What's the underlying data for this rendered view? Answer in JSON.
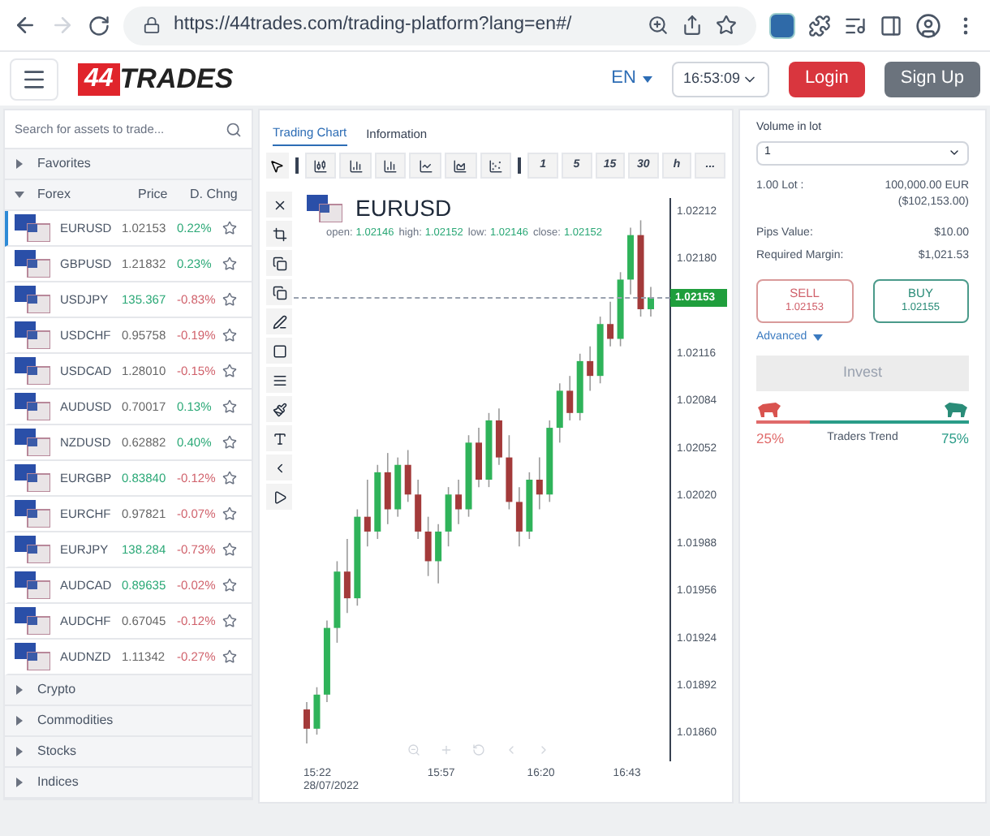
{
  "browser": {
    "url": "https://44trades.com/trading-platform?lang=en#/"
  },
  "header": {
    "logo_mark": "44",
    "logo_text": "TRADES",
    "language": "EN",
    "time": "16:53:09",
    "login": "Login",
    "signup": "Sign Up"
  },
  "assets": {
    "search_placeholder": "Search for assets to trade...",
    "groups_before": [
      {
        "label": "Favorites",
        "expanded": false
      }
    ],
    "forex": {
      "label": "Forex",
      "expanded": true,
      "price_header": "Price",
      "change_header": "D. Chng",
      "rows": [
        {
          "symbol": "EURUSD",
          "price": {
            "text": "1.02153",
            "color": "#666666"
          },
          "change": {
            "text": "0.22%",
            "color": "#2aa876"
          },
          "selected": true
        },
        {
          "symbol": "GBPUSD",
          "price": {
            "text": "1.21832",
            "color": "#666666"
          },
          "change": {
            "text": "0.23%",
            "color": "#2aa876"
          },
          "selected": false
        },
        {
          "symbol": "USDJPY",
          "price": {
            "text": "135.367",
            "color": "#2aa876"
          },
          "change": {
            "text": "-0.83%",
            "color": "#d0616b"
          },
          "selected": false
        },
        {
          "symbol": "USDCHF",
          "price": {
            "text": "0.95758",
            "color": "#666666"
          },
          "change": {
            "text": "-0.19%",
            "color": "#d0616b"
          },
          "selected": false
        },
        {
          "symbol": "USDCAD",
          "price": {
            "text": "1.28010",
            "color": "#666666"
          },
          "change": {
            "text": "-0.15%",
            "color": "#d0616b"
          },
          "selected": false
        },
        {
          "symbol": "AUDUSD",
          "price": {
            "text": "0.70017",
            "color": "#666666"
          },
          "change": {
            "text": "0.13%",
            "color": "#2aa876"
          },
          "selected": false
        },
        {
          "symbol": "NZDUSD",
          "price": {
            "text": "0.62882",
            "color": "#666666"
          },
          "change": {
            "text": "0.40%",
            "color": "#2aa876"
          },
          "selected": false
        },
        {
          "symbol": "EURGBP",
          "price": {
            "text": "0.83840",
            "color": "#2aa876"
          },
          "change": {
            "text": "-0.12%",
            "color": "#d0616b"
          },
          "selected": false
        },
        {
          "symbol": "EURCHF",
          "price": {
            "text": "0.97821",
            "color": "#666666"
          },
          "change": {
            "text": "-0.07%",
            "color": "#d0616b"
          },
          "selected": false
        },
        {
          "symbol": "EURJPY",
          "price": {
            "text": "138.284",
            "color": "#2aa876"
          },
          "change": {
            "text": "-0.73%",
            "color": "#d0616b"
          },
          "selected": false
        },
        {
          "symbol": "AUDCAD",
          "price": {
            "text": "0.89635",
            "color": "#2aa876"
          },
          "change": {
            "text": "-0.02%",
            "color": "#d0616b"
          },
          "selected": false
        },
        {
          "symbol": "AUDCHF",
          "price": {
            "text": "0.67045",
            "color": "#666666"
          },
          "change": {
            "text": "-0.12%",
            "color": "#d0616b"
          },
          "selected": false
        },
        {
          "symbol": "AUDNZD",
          "price": {
            "text": "1.11342",
            "color": "#666666"
          },
          "change": {
            "text": "-0.27%",
            "color": "#d0616b"
          },
          "selected": false
        }
      ]
    },
    "groups_after": [
      {
        "label": "Crypto",
        "expanded": false
      },
      {
        "label": "Commodities",
        "expanded": false
      },
      {
        "label": "Stocks",
        "expanded": false
      },
      {
        "label": "Indices",
        "expanded": false
      }
    ]
  },
  "chart": {
    "tabs": [
      {
        "label": "Trading Chart",
        "selected": true
      },
      {
        "label": "Information",
        "selected": false
      }
    ],
    "timeframes": [
      "1",
      "5",
      "15",
      "30",
      "h",
      "..."
    ],
    "symbol": "EURUSD",
    "ohlc": [
      {
        "label": "open:",
        "value": "1.02146"
      },
      {
        "label": "high:",
        "value": "1.02152"
      },
      {
        "label": "low:",
        "value": "1.02146"
      },
      {
        "label": "close:",
        "value": "1.02152"
      }
    ],
    "current_price": "1.02153",
    "time_axis": [
      {
        "label": "15:22",
        "date": "28/07/2022"
      },
      {
        "label": "15:57"
      },
      {
        "label": "16:20"
      },
      {
        "label": "16:43"
      }
    ],
    "chart_data": {
      "type": "candlestick",
      "ylim": [
        1.0184,
        1.0222
      ],
      "yticks": [
        {
          "value": 1.02212,
          "label": "1.02212"
        },
        {
          "value": 1.0218,
          "label": "1.02180"
        },
        {
          "value": 1.02116,
          "label": "1.02116"
        },
        {
          "value": 1.02084,
          "label": "1.02084"
        },
        {
          "value": 1.02052,
          "label": "1.02052"
        },
        {
          "value": 1.0202,
          "label": "1.02020"
        },
        {
          "value": 1.01988,
          "label": "1.01988"
        },
        {
          "value": 1.01956,
          "label": "1.01956"
        },
        {
          "value": 1.01924,
          "label": "1.01924"
        },
        {
          "value": 1.01892,
          "label": "1.01892"
        },
        {
          "value": 1.0186,
          "label": "1.01860"
        }
      ],
      "ohlc": [
        [
          1.01875,
          1.0188,
          1.01852,
          1.01862
        ],
        [
          1.01862,
          1.0189,
          1.01858,
          1.01885
        ],
        [
          1.01885,
          1.01935,
          1.0188,
          1.0193
        ],
        [
          1.0193,
          1.01975,
          1.0192,
          1.01968
        ],
        [
          1.01968,
          1.0199,
          1.0194,
          1.0195
        ],
        [
          1.0195,
          1.0201,
          1.01945,
          1.02005
        ],
        [
          1.02005,
          1.0203,
          1.01985,
          1.01995
        ],
        [
          1.01995,
          1.0204,
          1.0199,
          1.02035
        ],
        [
          1.02035,
          1.02048,
          1.02,
          1.0201
        ],
        [
          1.0201,
          1.02045,
          1.02005,
          1.0204
        ],
        [
          1.0204,
          1.0205,
          1.02015,
          1.0202
        ],
        [
          1.0202,
          1.0203,
          1.0199,
          1.01995
        ],
        [
          1.01995,
          1.02005,
          1.01965,
          1.01975
        ],
        [
          1.01975,
          1.02,
          1.0196,
          1.01995
        ],
        [
          1.01995,
          1.02025,
          1.01985,
          1.0202
        ],
        [
          1.0202,
          1.0203,
          1.02,
          1.0201
        ],
        [
          1.0201,
          1.0206,
          1.02005,
          1.02055
        ],
        [
          1.02055,
          1.02065,
          1.02025,
          1.0203
        ],
        [
          1.0203,
          1.02075,
          1.02025,
          1.0207
        ],
        [
          1.0207,
          1.02078,
          1.0204,
          1.02045
        ],
        [
          1.02045,
          1.0206,
          1.0201,
          1.02015
        ],
        [
          1.02015,
          1.02025,
          1.01985,
          1.01995
        ],
        [
          1.01995,
          1.02035,
          1.0199,
          1.0203
        ],
        [
          1.0203,
          1.02045,
          1.0201,
          1.0202
        ],
        [
          1.0202,
          1.0207,
          1.02015,
          1.02065
        ],
        [
          1.02065,
          1.02095,
          1.02055,
          1.0209
        ],
        [
          1.0209,
          1.021,
          1.0207,
          1.02075
        ],
        [
          1.02075,
          1.02115,
          1.0207,
          1.0211
        ],
        [
          1.0211,
          1.0212,
          1.0209,
          1.021
        ],
        [
          1.021,
          1.0214,
          1.02095,
          1.02135
        ],
        [
          1.02135,
          1.0215,
          1.0212,
          1.02125
        ],
        [
          1.02125,
          1.0217,
          1.0212,
          1.02165
        ],
        [
          1.02165,
          1.022,
          1.02155,
          1.02195
        ],
        [
          1.02195,
          1.02205,
          1.0214,
          1.02145
        ],
        [
          1.02145,
          1.0216,
          1.0214,
          1.02153
        ]
      ]
    }
  },
  "order": {
    "volume_label": "Volume in lot",
    "volume": "1",
    "lot_label": "1.00 Lot :",
    "lot_value": "100,000.00 EUR",
    "lot_value_usd": "($102,153.00)",
    "pips_label": "Pips Value:",
    "pips_value": "$10.00",
    "margin_label": "Required Margin:",
    "margin_value": "$1,021.53",
    "sell_label": "SELL",
    "sell_price": "1.02153",
    "buy_label": "BUY",
    "buy_price": "1.02155",
    "advanced": "Advanced",
    "invest": "Invest",
    "invest_disabled": true,
    "trend": {
      "level": 0.25,
      "sell_share": "25%",
      "label": "Traders Trend",
      "buy_share": "75%"
    }
  }
}
